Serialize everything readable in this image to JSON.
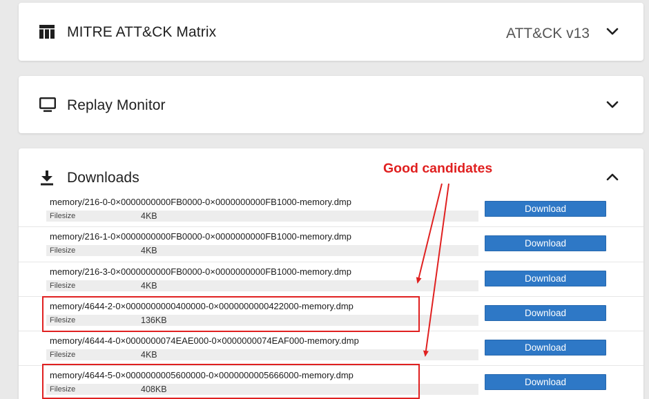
{
  "panels": {
    "attack": {
      "title": "MITRE ATT&CK Matrix",
      "version": "ATT&CK v13",
      "icon": "table-icon",
      "state": "collapsed"
    },
    "replay": {
      "title": "Replay Monitor",
      "icon": "monitor-icon",
      "state": "collapsed"
    },
    "downloads": {
      "title": "Downloads",
      "icon": "download-icon",
      "state": "expanded"
    }
  },
  "downloads": {
    "size_label": "Filesize",
    "button_label": "Download",
    "items": [
      {
        "filename": "memory/216-0-0×0000000000FB0000-0×0000000000FB1000-memory.dmp",
        "size": "4KB"
      },
      {
        "filename": "memory/216-1-0×0000000000FB0000-0×0000000000FB1000-memory.dmp",
        "size": "4KB"
      },
      {
        "filename": "memory/216-3-0×0000000000FB0000-0×0000000000FB1000-memory.dmp",
        "size": "4KB"
      },
      {
        "filename": "memory/4644-2-0×0000000000400000-0×0000000000422000-memory.dmp",
        "size": "136KB"
      },
      {
        "filename": "memory/4644-4-0×0000000074EAE000-0×0000000074EAF000-memory.dmp",
        "size": "4KB"
      },
      {
        "filename": "memory/4644-5-0×0000000005600000-0×0000000005666000-memory.dmp",
        "size": "408KB"
      }
    ]
  },
  "annotation": {
    "text": "Good candidates",
    "color": "#e02020"
  },
  "colors": {
    "button": "#2e78c6",
    "highlight": "#e02020",
    "background": "#e9e9e9"
  }
}
